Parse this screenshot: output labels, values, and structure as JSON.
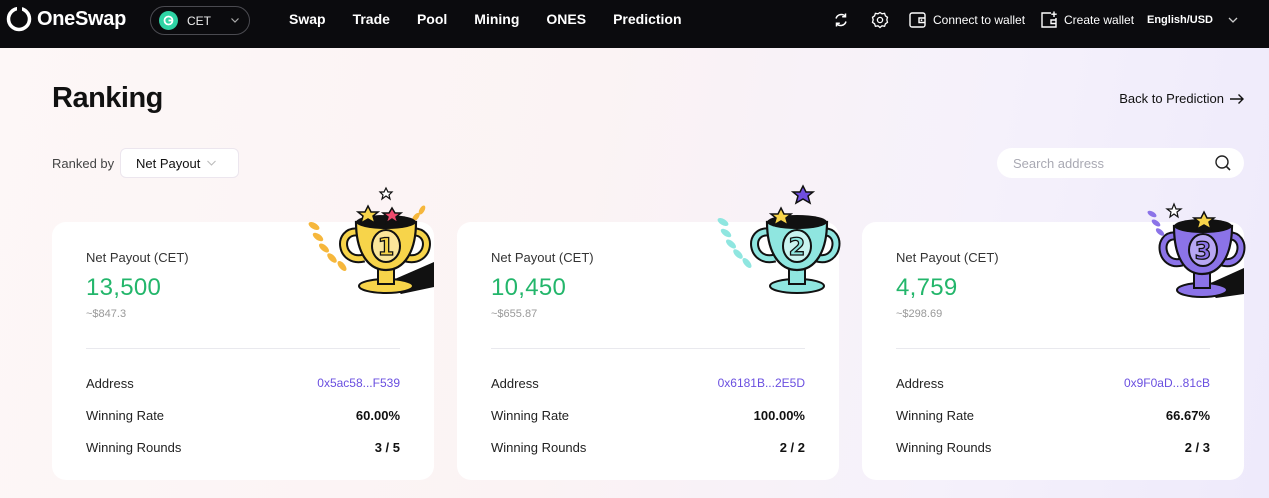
{
  "app": {
    "name": "OneSwap"
  },
  "header": {
    "chain": {
      "label": "CET",
      "icon": "cet-coin-icon"
    },
    "nav": [
      "Swap",
      "Trade",
      "Pool",
      "Mining",
      "ONES",
      "Prediction"
    ],
    "refresh_icon": "refresh-icon",
    "settings_icon": "gear-icon",
    "connect_wallet": "Connect to wallet",
    "create_wallet": "Create wallet",
    "language": "English/USD"
  },
  "page": {
    "title": "Ranking",
    "back_link": "Back to Prediction",
    "ranked_by_label": "Ranked by",
    "ranked_by_value": "Net Payout",
    "search_placeholder": "Search address"
  },
  "cards": [
    {
      "rank": "1",
      "label": "Net Payout (CET)",
      "amount": "13,500",
      "usd": "~$847.3",
      "address_label": "Address",
      "address": "0x5ac58...F539",
      "winning_rate_label": "Winning Rate",
      "winning_rate": "60.00%",
      "winning_rounds_label": "Winning Rounds",
      "winning_rounds": "3 / 5",
      "trophy_color": "#f7d44a"
    },
    {
      "rank": "2",
      "label": "Net Payout (CET)",
      "amount": "10,450",
      "usd": "~$655.87",
      "address_label": "Address",
      "address": "0x6181B...2E5D",
      "winning_rate_label": "Winning Rate",
      "winning_rate": "100.00%",
      "winning_rounds_label": "Winning Rounds",
      "winning_rounds": "2 / 2",
      "trophy_color": "#8fe6e0"
    },
    {
      "rank": "3",
      "label": "Net Payout (CET)",
      "amount": "4,759",
      "usd": "~$298.69",
      "address_label": "Address",
      "address": "0x9F0aD...81cB",
      "winning_rate_label": "Winning Rate",
      "winning_rate": "66.67%",
      "winning_rounds_label": "Winning Rounds",
      "winning_rounds": "2 / 3",
      "trophy_color": "#8b73e8"
    }
  ],
  "colors": {
    "accent_green": "#23b66b",
    "address_purple": "#6a4fe0",
    "nav_bg": "#0b0b0e"
  }
}
